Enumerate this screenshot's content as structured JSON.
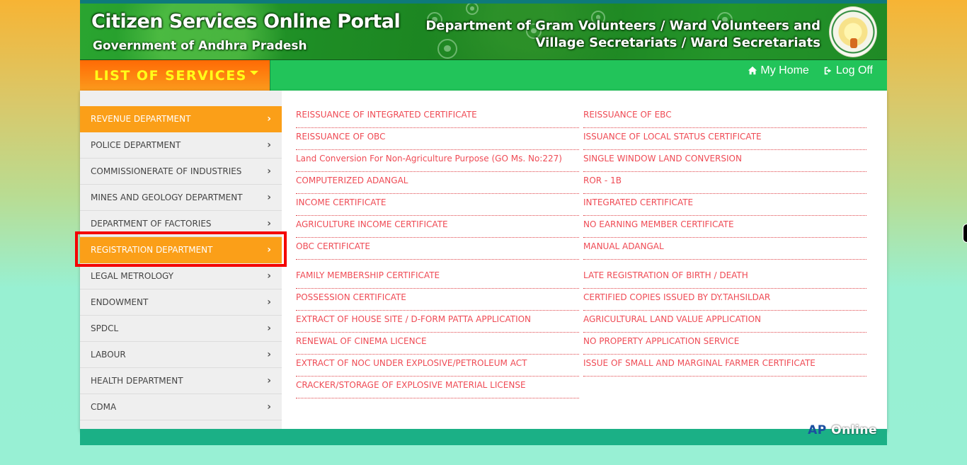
{
  "header": {
    "title": "Citizen Services Online Portal",
    "subtitle": "Government of Andhra Pradesh",
    "department_line1": "Department of Gram Volunteers / Ward Volunteers and",
    "department_line2": "Village Secretariats / Ward Secretariats",
    "emblem": "andhra-pradesh-emblem"
  },
  "navbar": {
    "menu_label": "LIST OF SERVICES",
    "links": [
      {
        "label": "My Home",
        "icon": "home-icon"
      },
      {
        "label": "Log Off",
        "icon": "sign-out-icon"
      }
    ]
  },
  "sidebar": {
    "items": [
      {
        "label": "REVENUE DEPARTMENT",
        "active": true
      },
      {
        "label": "POLICE DEPARTMENT",
        "active": false
      },
      {
        "label": "COMMISSIONERATE OF INDUSTRIES",
        "active": false
      },
      {
        "label": "MINES AND GEOLOGY DEPARTMENT",
        "active": false
      },
      {
        "label": "DEPARTMENT OF FACTORIES",
        "active": false
      },
      {
        "label": "REGISTRATION DEPARTMENT",
        "active": true,
        "highlighted": true
      },
      {
        "label": "LEGAL METROLOGY",
        "active": false
      },
      {
        "label": "ENDOWMENT",
        "active": false
      },
      {
        "label": "SPDCL",
        "active": false
      },
      {
        "label": "LABOUR",
        "active": false
      },
      {
        "label": "HEALTH DEPARTMENT",
        "active": false
      },
      {
        "label": "CDMA",
        "active": false
      }
    ],
    "chevron": "›"
  },
  "services": {
    "left": [
      "REISSUANCE OF INTEGRATED CERTIFICATE",
      "REISSUANCE OF OBC",
      "Land Conversion For Non-Agriculture Purpose (GO Ms. No:227)",
      "COMPUTERIZED ADANGAL",
      "INCOME CERTIFICATE",
      "AGRICULTURE INCOME CERTIFICATE",
      "OBC CERTIFICATE",
      "FAMILY MEMBERSHIP CERTIFICATE",
      "POSSESSION CERTIFICATE",
      "EXTRACT OF HOUSE SITE / D-FORM PATTA APPLICATION",
      "RENEWAL OF CINEMA LICENCE",
      "EXTRACT OF NOC UNDER EXPLOSIVE/PETROLEUM ACT",
      "CRACKER/STORAGE OF EXPLOSIVE MATERIAL LICENSE"
    ],
    "right": [
      "REISSUANCE OF EBC",
      "ISSUANCE OF LOCAL STATUS CERTIFICATE",
      "SINGLE WINDOW LAND CONVERSION",
      "ROR - 1B",
      "INTEGRATED CERTIFICATE",
      "NO EARNING MEMBER CERTIFICATE",
      "MANUAL ADANGAL",
      "LATE REGISTRATION OF BIRTH / DEATH",
      "CERTIFIED COPIES ISSUED BY DY.TAHSILDAR",
      "AGRICULTURAL LAND VALUE APPLICATION",
      "NO PROPERTY APPLICATION SERVICE",
      "ISSUE OF SMALL AND MARGINAL FARMER CERTIFICATE"
    ]
  },
  "footer": {
    "brand_part1": "AP",
    "brand_part2": "Online"
  },
  "colors": {
    "accent_orange": "#fb9f18",
    "nav_green": "#22c45a",
    "link_red": "#ef4b55",
    "menu_yellow": "#ffff1a",
    "highlight_red": "#f40000",
    "footer_green": "#1bb086"
  }
}
